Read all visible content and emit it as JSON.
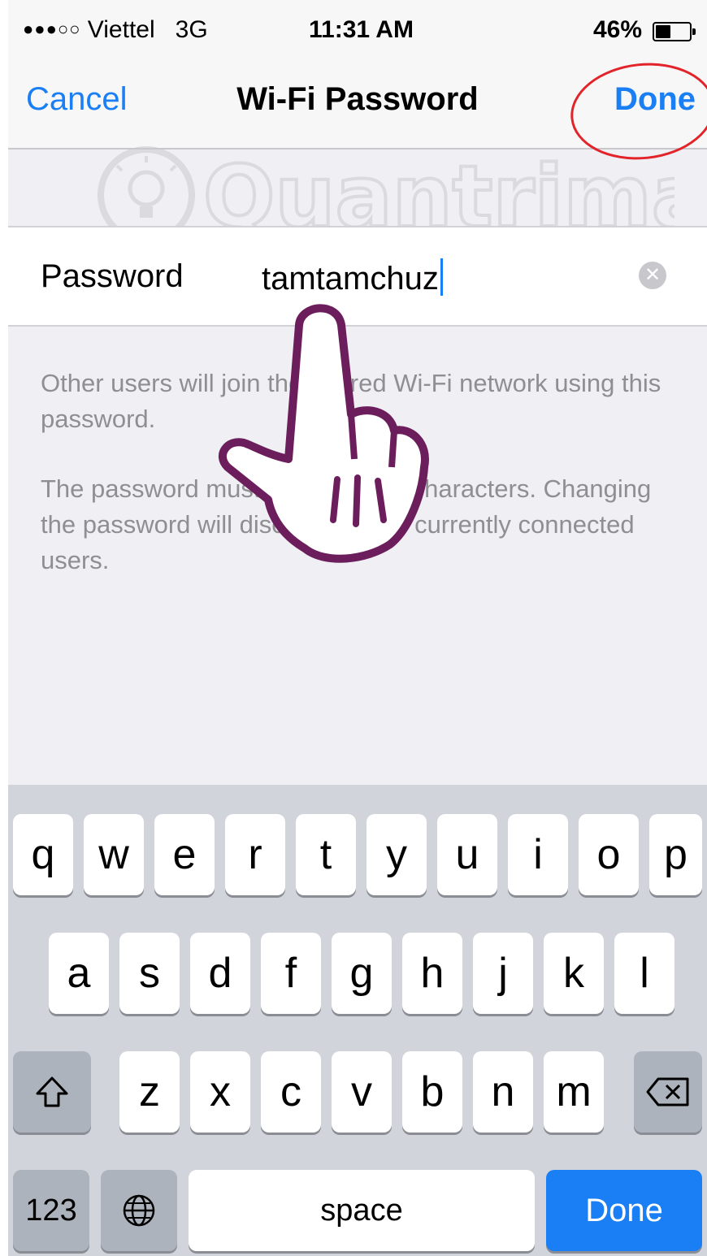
{
  "status_bar": {
    "signal_dots": "●●●○○",
    "carrier": "Viettel",
    "network": "3G",
    "time": "11:31 AM",
    "battery_percent": "46%",
    "battery_level": 0.46
  },
  "nav": {
    "cancel_label": "Cancel",
    "title": "Wi-Fi Password",
    "done_label": "Done"
  },
  "password_cell": {
    "label": "Password",
    "value": "tamtamchuz"
  },
  "footer": {
    "text_1": "Other users will join the shared Wi-Fi network using this password.",
    "text_2": "The password must be at least 8 characters. Changing the password will disconnect any currently connected users."
  },
  "watermark_text": "Quantrimang",
  "keyboard": {
    "row1": [
      "q",
      "w",
      "e",
      "r",
      "t",
      "y",
      "u",
      "i",
      "o",
      "p"
    ],
    "row2": [
      "a",
      "s",
      "d",
      "f",
      "g",
      "h",
      "j",
      "k",
      "l"
    ],
    "row3": [
      "z",
      "x",
      "c",
      "v",
      "b",
      "n",
      "m"
    ],
    "shift_icon": "shift-icon",
    "delete_icon": "delete-icon",
    "numbers_label": "123",
    "globe_icon": "globe-icon",
    "space_label": "space",
    "done_label": "Done"
  },
  "colors": {
    "accent": "#1a7ff5",
    "annotation_circle": "#e2242a",
    "hand_outline": "#6b1d5c"
  }
}
